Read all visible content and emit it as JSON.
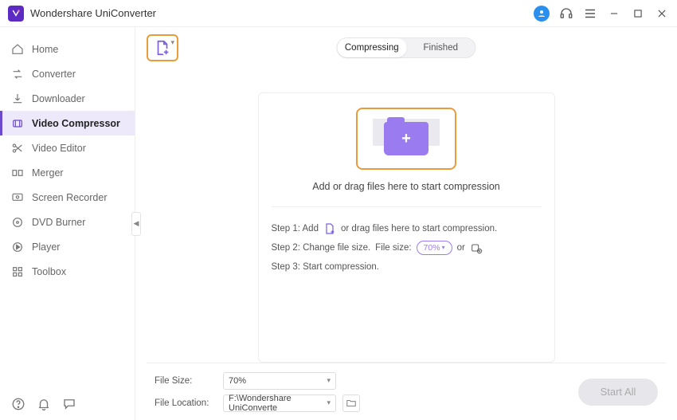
{
  "app": {
    "title": "Wondershare UniConverter"
  },
  "sidebar": {
    "items": [
      {
        "label": "Home"
      },
      {
        "label": "Converter"
      },
      {
        "label": "Downloader"
      },
      {
        "label": "Video Compressor"
      },
      {
        "label": "Video Editor"
      },
      {
        "label": "Merger"
      },
      {
        "label": "Screen Recorder"
      },
      {
        "label": "DVD Burner"
      },
      {
        "label": "Player"
      },
      {
        "label": "Toolbox"
      }
    ],
    "activeIndex": 3
  },
  "tabs": {
    "compressing": "Compressing",
    "finished": "Finished"
  },
  "dropzone": {
    "caption": "Add or drag files here to start compression"
  },
  "steps": {
    "s1a": "Step 1: Add",
    "s1b": "or drag files here to start compression.",
    "s2a": "Step 2: Change file size.",
    "s2b": "File size:",
    "s2pill": "70%",
    "s2or": "or",
    "s3": "Step 3: Start compression."
  },
  "footer": {
    "fileSizeLabel": "File Size:",
    "fileSizeValue": "70%",
    "fileLocationLabel": "File Location:",
    "fileLocationValue": "F:\\Wondershare UniConverte",
    "startAll": "Start All"
  }
}
